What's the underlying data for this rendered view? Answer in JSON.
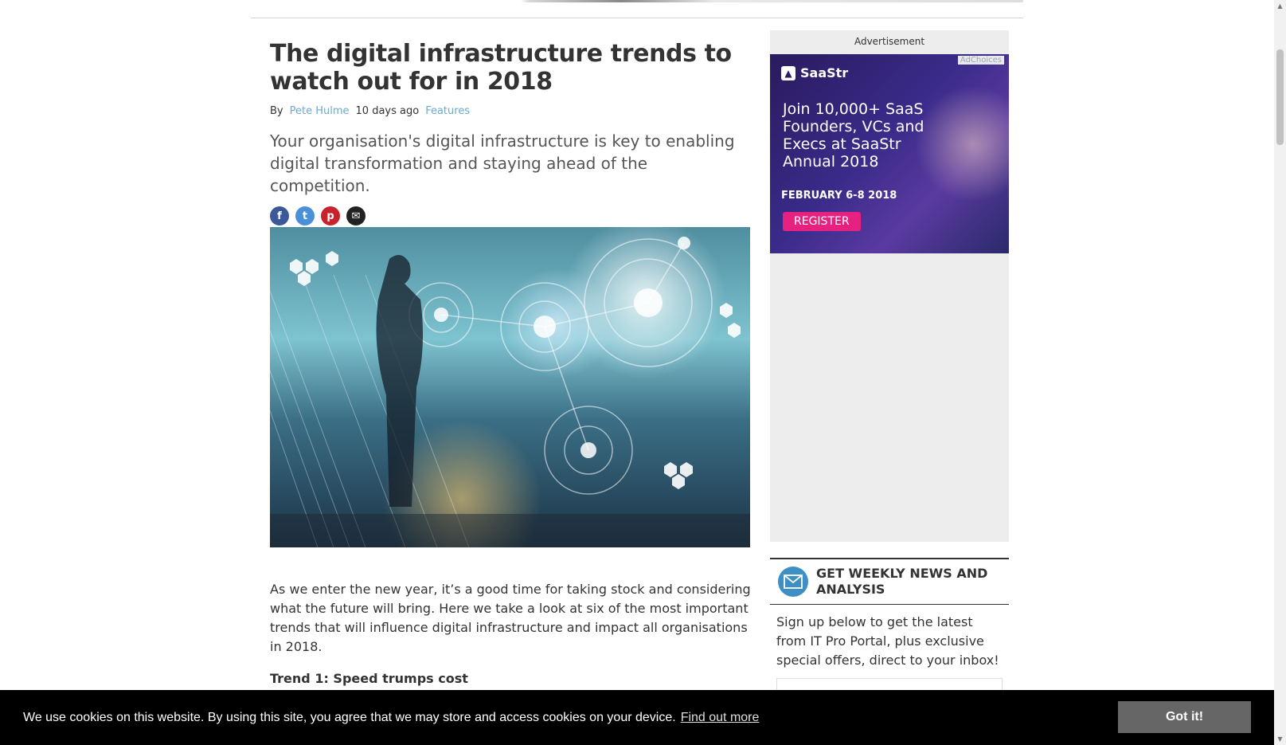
{
  "article": {
    "title": "The digital infrastructure trends to watch out for in 2018",
    "byline_prefix": "By",
    "author": "Pete Hulme",
    "time_ago": "10 days ago",
    "category": "Features",
    "strap": "Your organisation's digital infrastructure is key to enabling digital transformation and staying ahead of the competition.",
    "share": [
      {
        "name": "facebook-icon",
        "glyph": "f"
      },
      {
        "name": "twitter-icon",
        "glyph": "t"
      },
      {
        "name": "pinterest-icon",
        "glyph": "p"
      },
      {
        "name": "email-icon",
        "glyph": "✉"
      }
    ],
    "intro": "As we enter the new year, it’s a good time for taking stock and considering what the future will bring. Here we take a look at six of the most important trends that will influence digital infrastructure and impact all   organisations in 2018.",
    "trend_heading": "Trend 1: Speed trumps cost"
  },
  "advert": {
    "label": "Advertisement",
    "adchoices": "AdChoices",
    "brand": "SaaStr",
    "headline": "Join 10,000+ SaaS Founders, VCs and Execs at SaaStr Annual 2018",
    "date": "FEBRUARY 6-8 2018",
    "cta": "REGISTER"
  },
  "newsletter": {
    "title": "GET WEEKLY NEWS AND ANALYSIS",
    "text": "Sign up below to get the latest from IT Pro Portal, plus exclusive special offers, direct to your inbox!"
  },
  "cookie": {
    "text": "We use cookies on this website. By using this site, you agree that we may store and access cookies on your device.",
    "link": "Find out more",
    "button": "Got it!"
  },
  "colors": {
    "link": "#6fa8c8",
    "facebook": "#3b5998",
    "twitter": "#4a90d9",
    "pinterest": "#c8232c",
    "ad_cta": "#e6217f",
    "newsletter_icon": "#3d8fc4"
  }
}
